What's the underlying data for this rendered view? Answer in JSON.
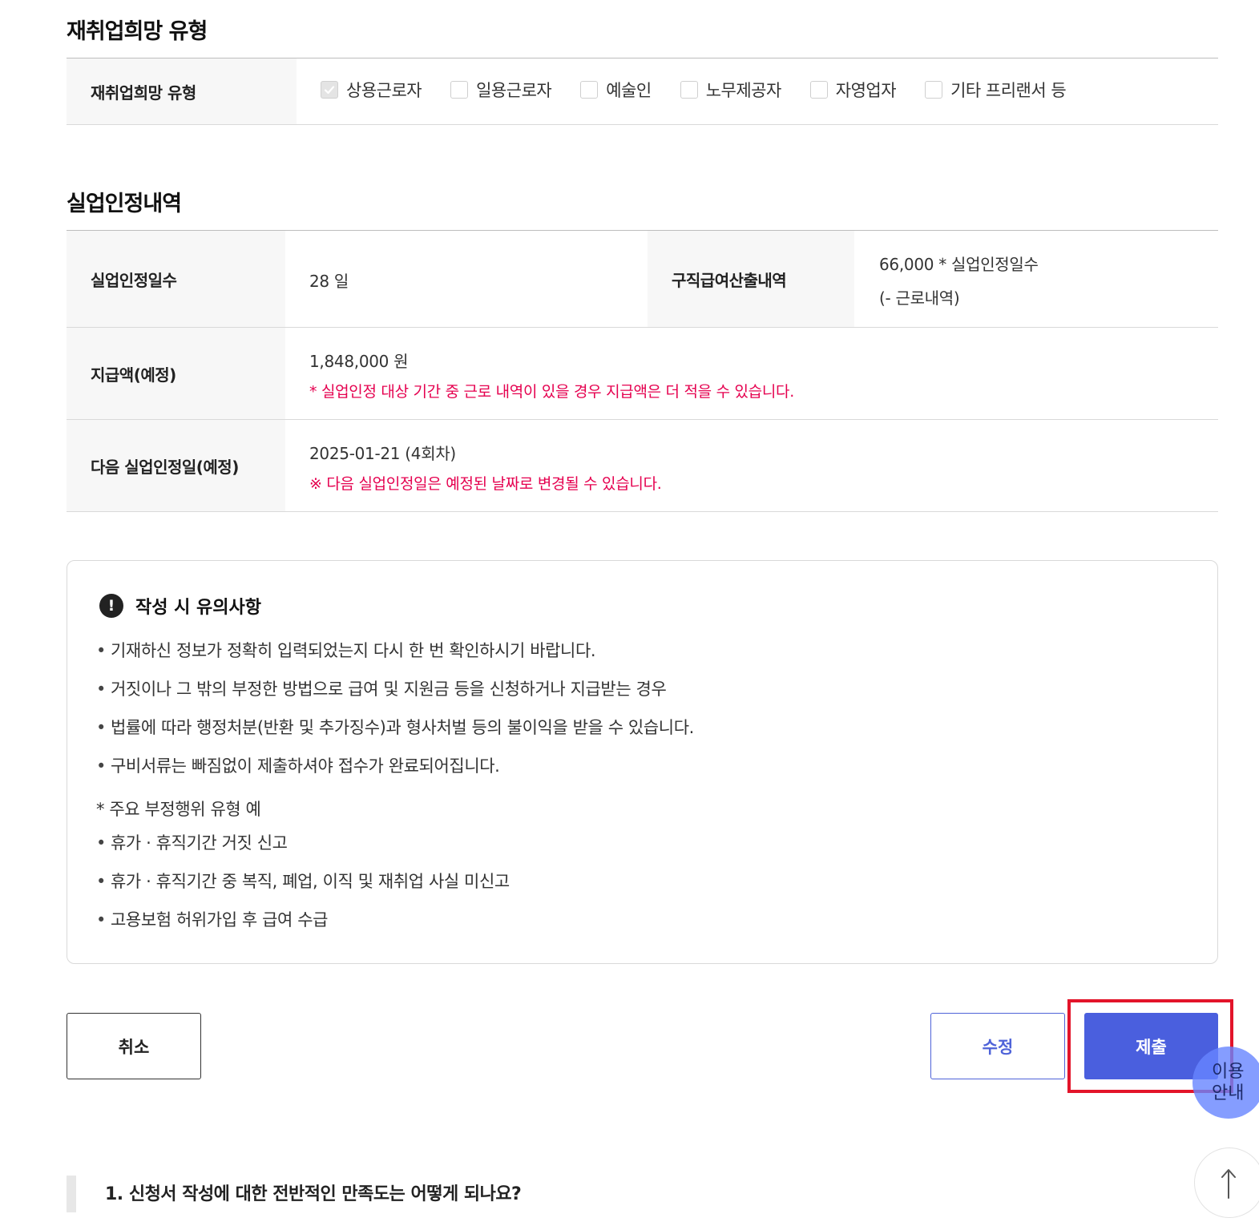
{
  "reemployment": {
    "section_title": "재취업희망 유형",
    "row_label": "재취업희망 유형",
    "options": [
      {
        "label": "상용근로자",
        "checked": true
      },
      {
        "label": "일용근로자",
        "checked": false
      },
      {
        "label": "예술인",
        "checked": false
      },
      {
        "label": "노무제공자",
        "checked": false
      },
      {
        "label": "자영업자",
        "checked": false
      },
      {
        "label": "기타 프리랜서 등",
        "checked": false
      }
    ]
  },
  "unemployment": {
    "section_title": "실업인정내역",
    "days_label": "실업인정일수",
    "days_value": "28 일",
    "calc_label": "구직급여산출내역",
    "calc_line1": "66,000 * 실업인정일수",
    "calc_line2": "(- 근로내역)",
    "amount_label": "지급액(예정)",
    "amount_value": "1,848,000 원",
    "amount_note": "* 실업인정 대상 기간 중 근로 내역이 있을 경우 지급액은 더 적을 수 있습니다.",
    "next_label": "다음 실업인정일(예정)",
    "next_value": "2025-01-21 (4회차)",
    "next_note": "※ 다음 실업인정일은 예정된 날짜로 변경될 수 있습니다."
  },
  "notice": {
    "title": "작성 시 유의사항",
    "bullets": [
      "기재하신 정보가 정확히 입력되었는지 다시 한 번 확인하시기 바랍니다.",
      "거짓이나 그 밖의 부정한 방법으로 급여 및 지원금 등을 신청하거나 지급받는 경우",
      "법률에 따라 행정처분(반환 및 추가징수)과 형사처벌 등의 불이익을 받을 수 있습니다.",
      "구비서류는 빠짐없이 제출하셔야 접수가 완료되어집니다."
    ],
    "fraud_heading": "* 주요 부정행위 유형 예",
    "fraud_items": [
      "휴가 · 휴직기간 거짓 신고",
      "휴가 · 휴직기간 중 복직, 폐업, 이직 및 재취업 사실 미신고",
      "고용보험 허위가입 후 급여 수급"
    ]
  },
  "buttons": {
    "cancel": "취소",
    "edit": "수정",
    "submit": "제출"
  },
  "floating": {
    "guide_line1": "이용",
    "guide_line2": "안내",
    "top_icon": "arrow-up-icon"
  },
  "survey": {
    "question": "1. 신청서 작성에 대한 전반적인 만족도는 어떻게 되나요?"
  },
  "colors": {
    "accent": "#4a5fde",
    "warning": "#e5004f",
    "highlight": "#e3142a"
  }
}
